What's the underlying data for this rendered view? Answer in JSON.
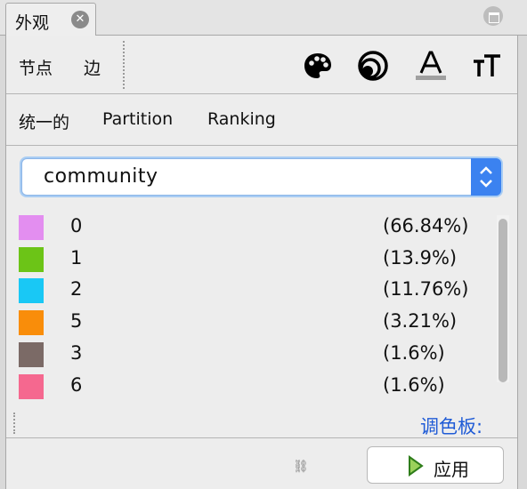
{
  "tab": {
    "title": "外观",
    "close_symbol": "✕"
  },
  "subtabs": {
    "nodes": "节点",
    "edges": "边"
  },
  "toolbar": {
    "tools": [
      {
        "icon": "palette-icon"
      },
      {
        "icon": "size-icon"
      },
      {
        "icon": "label-color-icon",
        "glyph": "A"
      },
      {
        "icon": "label-size-icon",
        "glyph": "TT"
      }
    ]
  },
  "modes": {
    "unique": "统一的",
    "partition": "Partition",
    "ranking": "Ranking"
  },
  "attribute_select": {
    "value": "community"
  },
  "partition_items": [
    {
      "label": "0",
      "percent": "(66.84%)",
      "color": "#e38ef0"
    },
    {
      "label": "1",
      "percent": "(13.9%)",
      "color": "#6cc417"
    },
    {
      "label": "2",
      "percent": "(11.76%)",
      "color": "#19c8f5"
    },
    {
      "label": "5",
      "percent": "(3.21%)",
      "color": "#f98d0a"
    },
    {
      "label": "3",
      "percent": "(1.6%)",
      "color": "#7b6a66"
    },
    {
      "label": "6",
      "percent": "(1.6%)",
      "color": "#f5688f"
    }
  ],
  "palette_link": "调色板:",
  "apply_button": {
    "label": "应用"
  }
}
